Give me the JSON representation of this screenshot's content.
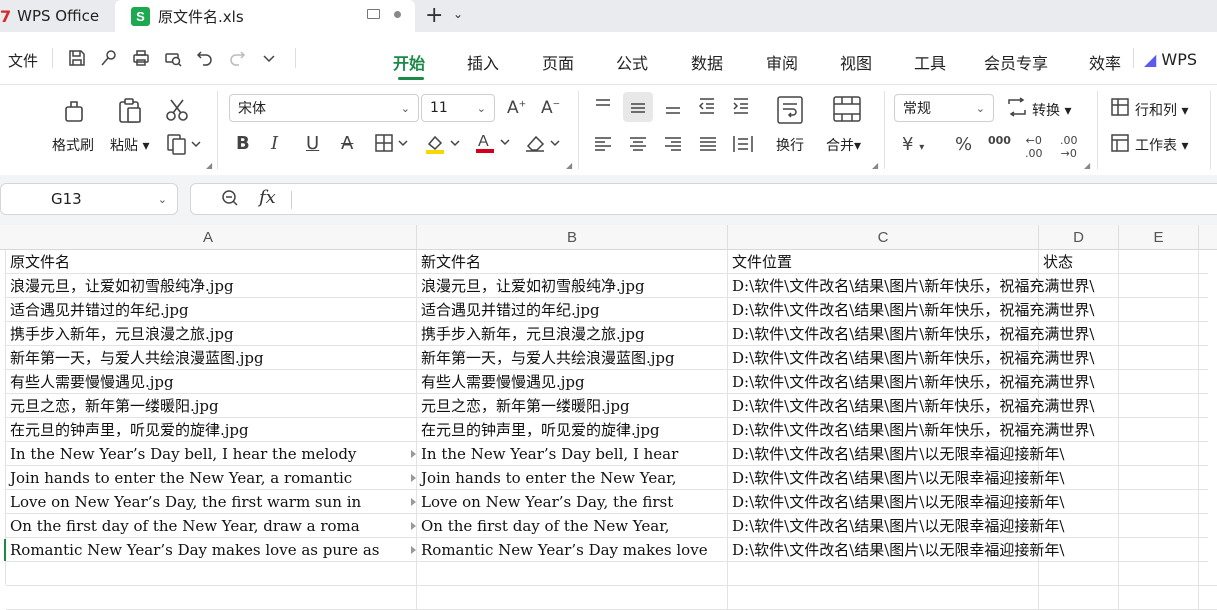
{
  "tabs": {
    "home": {
      "logo": "7",
      "label": "WPS Office"
    },
    "file": {
      "icon_letter": "S",
      "label": "原文件名.xls"
    },
    "add": "+"
  },
  "menu": {
    "file": "文件",
    "items": [
      "开始",
      "插入",
      "页面",
      "公式",
      "数据",
      "审阅",
      "视图",
      "工具",
      "会员专享",
      "效率"
    ],
    "active": "开始",
    "wps_ai": "WPS"
  },
  "ribbon": {
    "format_painter": "格式刷",
    "paste": "粘贴",
    "font_name": "宋体",
    "font_size": "11",
    "wrap": "换行",
    "merge": "合并",
    "number_format": "常规",
    "convert": "转换",
    "rowcol": "行和列",
    "sheet": "工作表",
    "bold": "B",
    "italic": "I",
    "underline": "U",
    "strike": "A",
    "currency": "¥",
    "percent": "%",
    "thousands": "000",
    "colors": {
      "accent": "#1a8a46",
      "highlight": "#f5d800",
      "font_color": "#d0021b"
    }
  },
  "formula_bar": {
    "cell_ref": "G13",
    "fx": "fx",
    "value": ""
  },
  "sheet": {
    "columns": [
      "A",
      "B",
      "C",
      "D",
      "E"
    ],
    "header_row": [
      "原文件名",
      "新文件名",
      "文件位置",
      "状态"
    ],
    "rows": [
      [
        "浪漫元旦，让爱如初雪般纯净.jpg",
        "浪漫元旦，让爱如初雪般纯净.jpg",
        "D:\\软件\\文件改名\\结果\\图片\\新年快乐，祝福充满世界\\"
      ],
      [
        "适合遇见并错过的年纪.jpg",
        "适合遇见并错过的年纪.jpg",
        "D:\\软件\\文件改名\\结果\\图片\\新年快乐，祝福充满世界\\"
      ],
      [
        "携手步入新年，元旦浪漫之旅.jpg",
        "携手步入新年，元旦浪漫之旅.jpg",
        "D:\\软件\\文件改名\\结果\\图片\\新年快乐，祝福充满世界\\"
      ],
      [
        "新年第一天，与爱人共绘浪漫蓝图.jpg",
        "新年第一天，与爱人共绘浪漫蓝图.jpg",
        "D:\\软件\\文件改名\\结果\\图片\\新年快乐，祝福充满世界\\"
      ],
      [
        "有些人需要慢慢遇见.jpg",
        "有些人需要慢慢遇见.jpg",
        "D:\\软件\\文件改名\\结果\\图片\\新年快乐，祝福充满世界\\"
      ],
      [
        "元旦之恋，新年第一缕暖阳.jpg",
        "元旦之恋，新年第一缕暖阳.jpg",
        "D:\\软件\\文件改名\\结果\\图片\\新年快乐，祝福充满世界\\"
      ],
      [
        "在元旦的钟声里，听见爱的旋律.jpg",
        "在元旦的钟声里，听见爱的旋律.jpg",
        "D:\\软件\\文件改名\\结果\\图片\\新年快乐，祝福充满世界\\"
      ],
      [
        "In the New Year’s Day bell, I hear the melody",
        "In the New Year’s Day bell, I hear",
        "D:\\软件\\文件改名\\结果\\图片\\以无限幸福迎接新年\\"
      ],
      [
        "Join hands to enter the New Year, a romantic",
        "Join hands to enter the New Year,",
        "D:\\软件\\文件改名\\结果\\图片\\以无限幸福迎接新年\\"
      ],
      [
        "Love on New Year’s Day, the first warm sun in",
        "Love on New Year’s Day, the first",
        "D:\\软件\\文件改名\\结果\\图片\\以无限幸福迎接新年\\"
      ],
      [
        "On the first day of the New Year, draw a roma",
        "On the first day of the New Year,",
        "D:\\软件\\文件改名\\结果\\图片\\以无限幸福迎接新年\\"
      ],
      [
        "Romantic New Year’s Day makes love as pure as",
        "Romantic New Year’s Day makes love",
        "D:\\软件\\文件改名\\结果\\图片\\以无限幸福迎接新年\\"
      ]
    ]
  }
}
